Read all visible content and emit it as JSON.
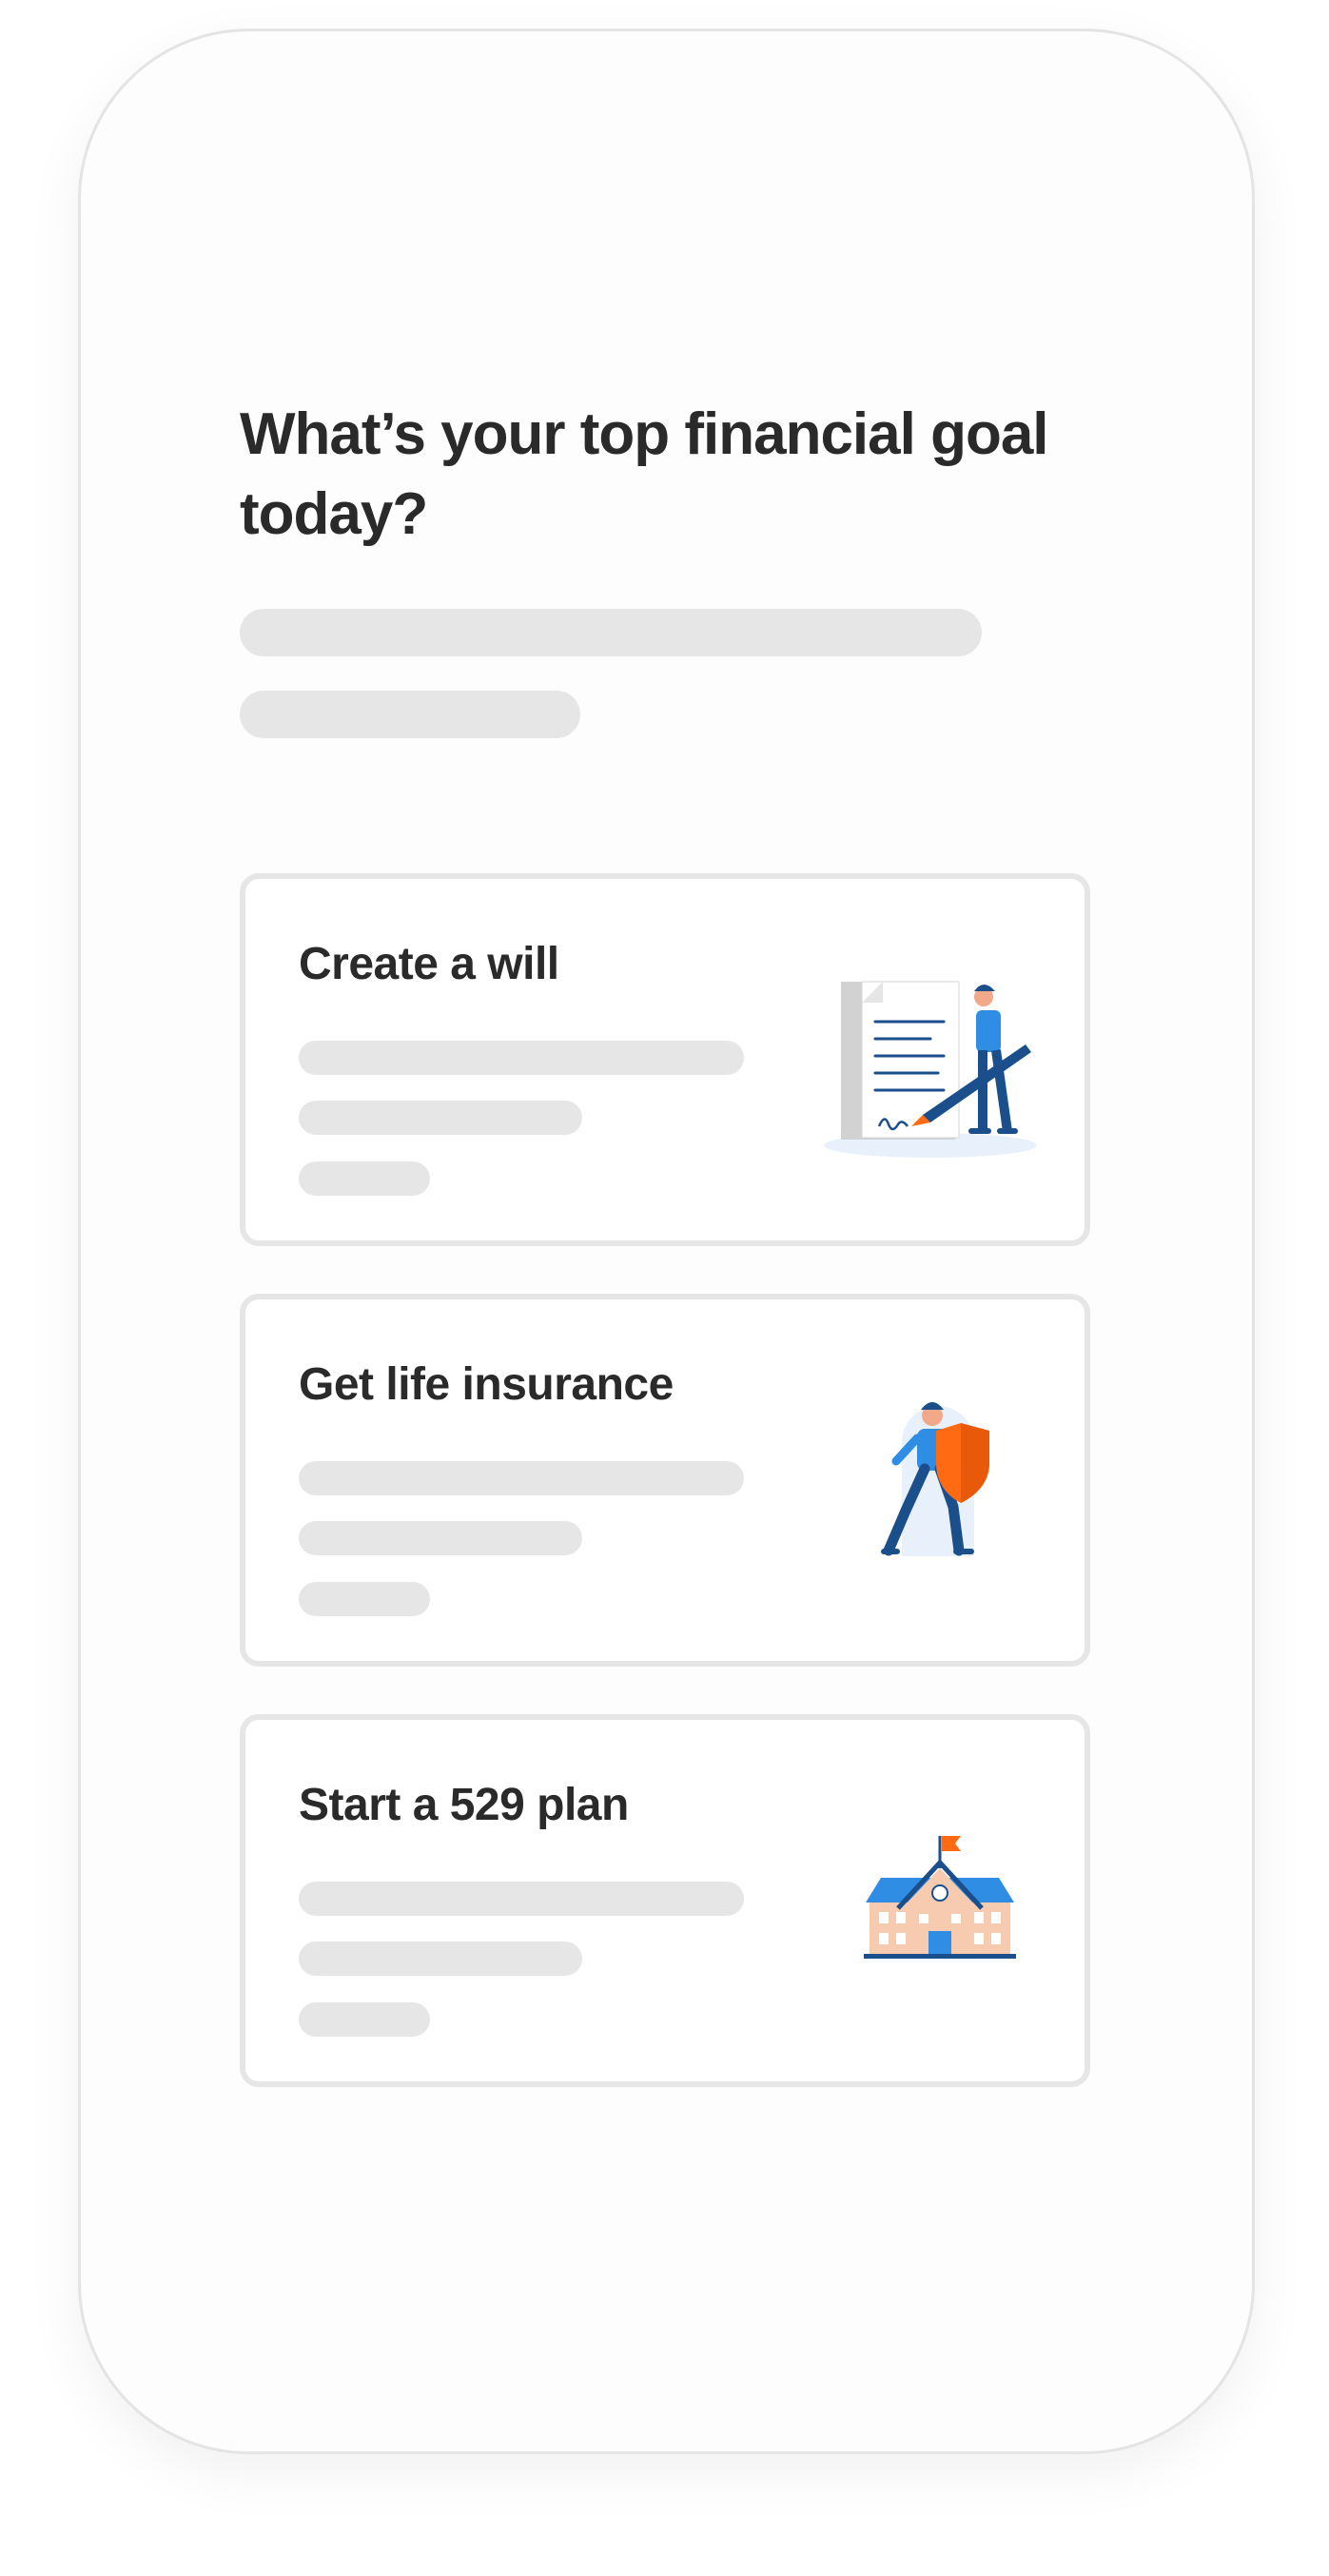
{
  "question": {
    "title": "What’s your top financial goal today?"
  },
  "options": [
    {
      "title": "Create a will",
      "icon": "will-document-icon"
    },
    {
      "title": "Get life insurance",
      "icon": "shield-person-icon"
    },
    {
      "title": "Start a 529 plan",
      "icon": "school-building-icon"
    }
  ],
  "colors": {
    "accent_blue": "#2f8de4",
    "navy": "#1a4f8b",
    "orange": "#ff6a13",
    "placeholder": "#e6e6e6"
  }
}
